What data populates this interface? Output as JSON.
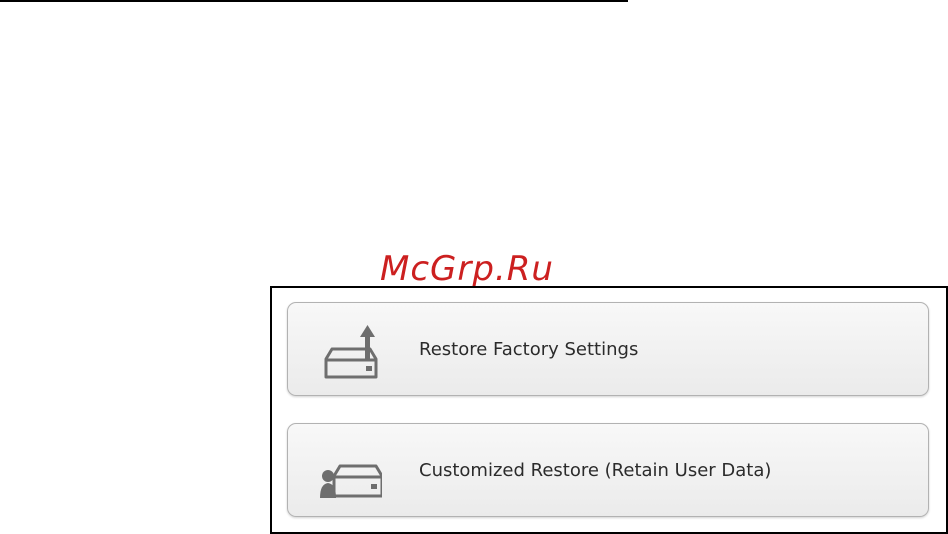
{
  "watermark": "McGrp.Ru",
  "options": [
    {
      "label": "Restore Factory Settings",
      "icon": "drive-upload-icon"
    },
    {
      "label": "Customized Restore (Retain User Data)",
      "icon": "drive-user-icon"
    }
  ],
  "colors": {
    "watermark": "#cc2020",
    "icon": "#6e6e6e",
    "button_border": "#b2b2b2",
    "text": "#2b2b2b"
  }
}
